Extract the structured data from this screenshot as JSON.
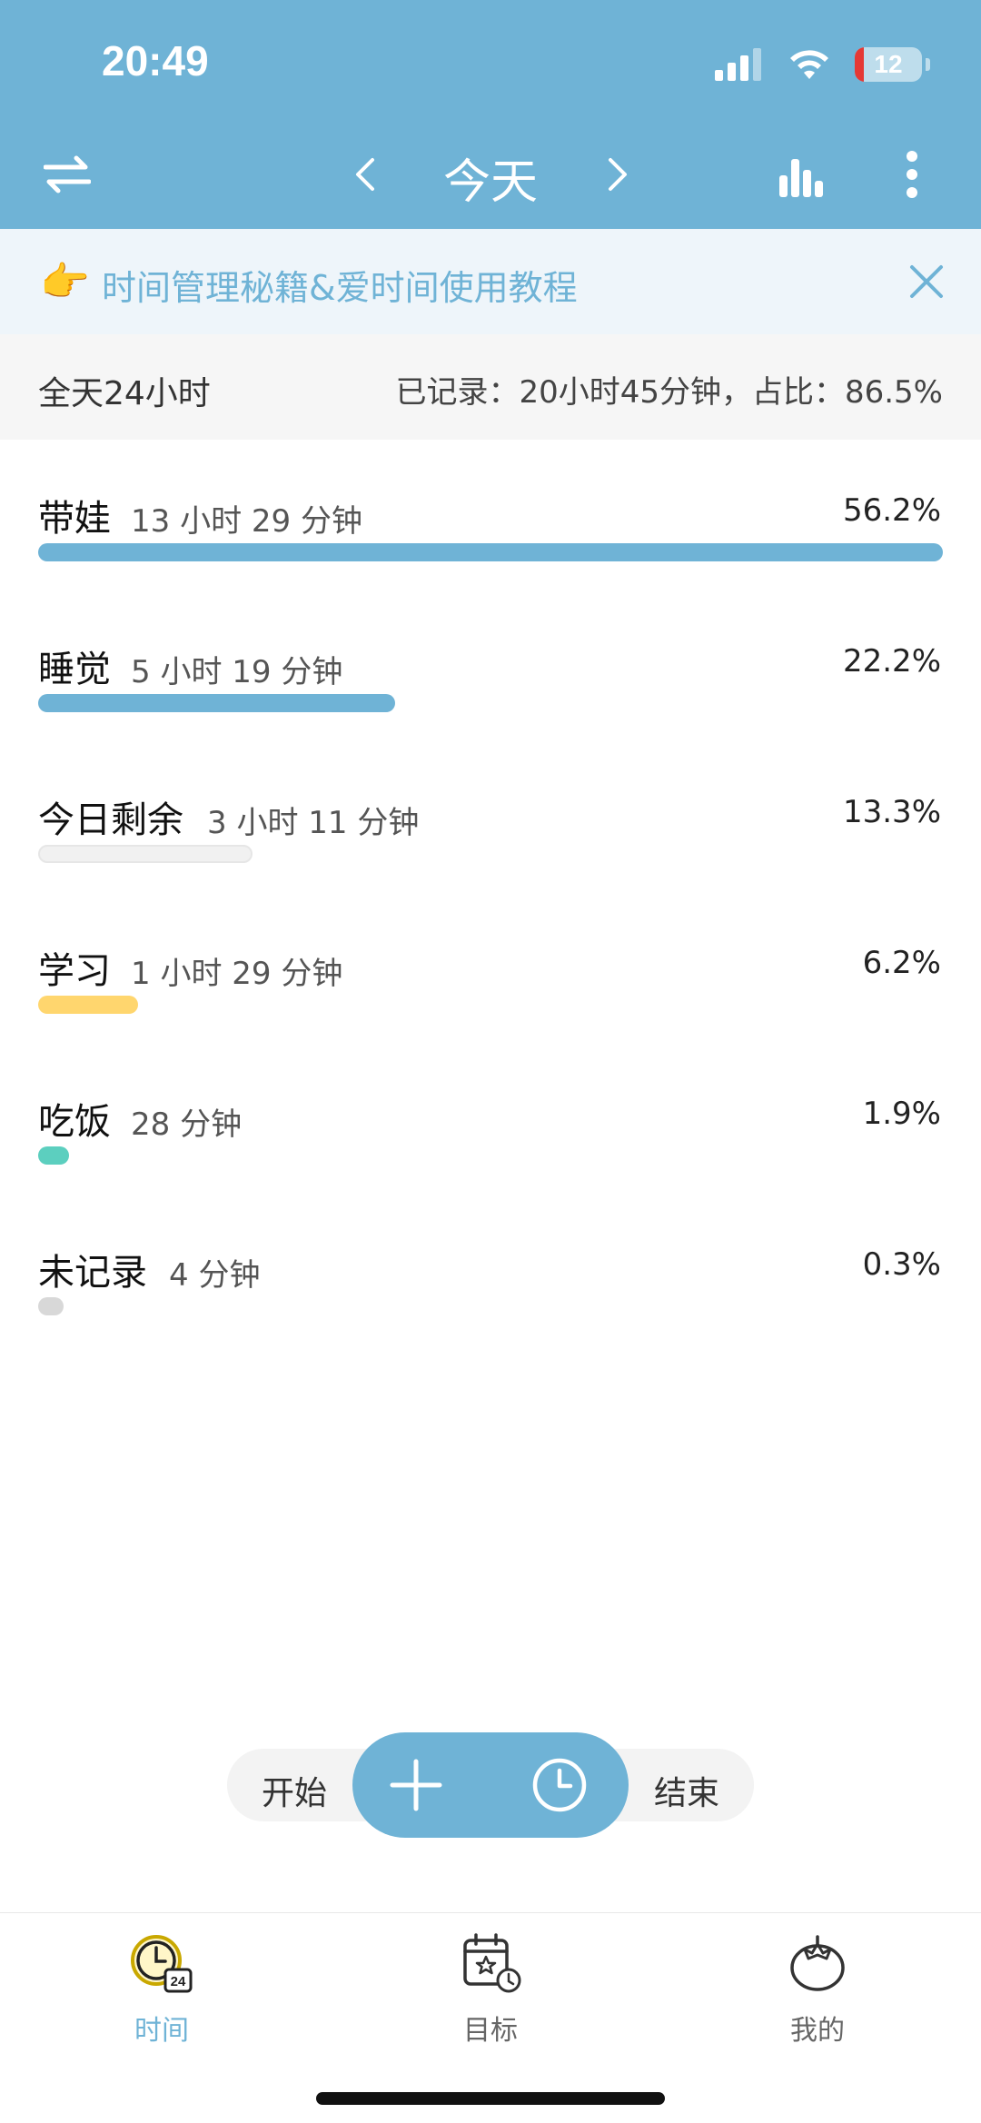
{
  "status_bar": {
    "time": "20:49",
    "battery": "12"
  },
  "nav": {
    "title": "今天"
  },
  "banner": {
    "emoji": "👉",
    "text": "时间管理秘籍&爱时间使用教程"
  },
  "summary": {
    "left": "全天24小时",
    "right": "已记录：20小时45分钟，占比：86.5%"
  },
  "categories": [
    {
      "name": "带娃",
      "duration": "13 小时 29 分钟",
      "percent": "56.2%",
      "fraction": 0.562,
      "color": "#6FB3D6"
    },
    {
      "name": "睡觉",
      "duration": "5 小时 19 分钟",
      "percent": "22.2%",
      "fraction": 0.222,
      "color": "#6FB3D6"
    },
    {
      "name": "今日剩余",
      "duration": "3 小时 11 分钟",
      "percent": "13.3%",
      "fraction": 0.133,
      "color": "#F1F1F1"
    },
    {
      "name": "学习",
      "duration": "1 小时 29 分钟",
      "percent": "6.2%",
      "fraction": 0.062,
      "color": "#FFD66E"
    },
    {
      "name": "吃饭",
      "duration": "28 分钟",
      "percent": "1.9%",
      "fraction": 0.019,
      "color": "#5CCFBF"
    },
    {
      "name": "未记录",
      "duration": "4 分钟",
      "percent": "0.3%",
      "fraction": 0.003,
      "color": "#D8D8D8"
    }
  ],
  "actions": {
    "start": "开始",
    "end": "结束"
  },
  "tabs": [
    {
      "label": "时间",
      "active": true
    },
    {
      "label": "目标",
      "active": false
    },
    {
      "label": "我的",
      "active": false
    }
  ],
  "colors": {
    "accent": "#6FB3D6",
    "inactive_tab": "#666666"
  }
}
